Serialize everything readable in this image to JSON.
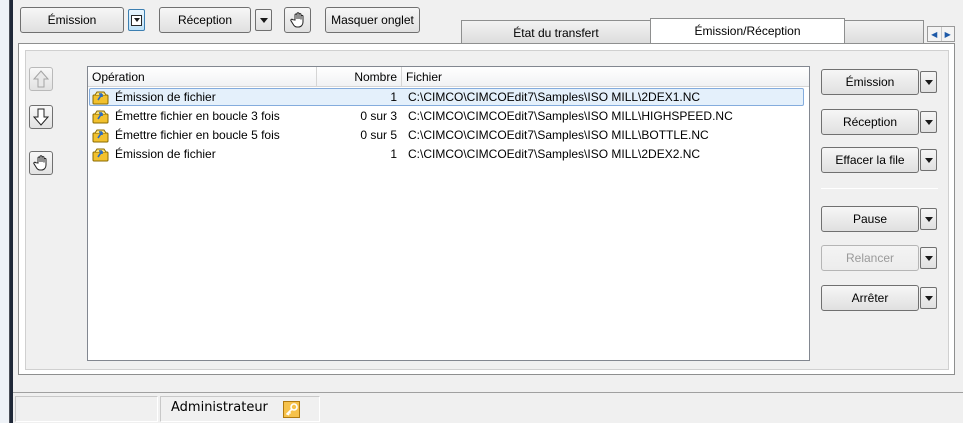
{
  "toolbar": {
    "emission_label": "Émission",
    "reception_label": "Réception",
    "hide_tabs_label": "Masquer onglet"
  },
  "tabs": [
    {
      "label": "État du transfert",
      "active": false
    },
    {
      "label": "Émission/Réception",
      "active": true
    },
    {
      "label": "",
      "active": false
    }
  ],
  "list": {
    "columns": [
      "Opération",
      "Nombre",
      "Fichier"
    ],
    "rows": [
      {
        "operation": "Émission de fichier",
        "count": "1",
        "file": "C:\\CIMCO\\CIMCOEdit7\\Samples\\ISO MILL\\2DEX1.NC",
        "selected": true
      },
      {
        "operation": "Émettre fichier en boucle 3 fois",
        "count": "0 sur 3",
        "file": "C:\\CIMCO\\CIMCOEdit7\\Samples\\ISO MILL\\HIGHSPEED.NC",
        "selected": false
      },
      {
        "operation": "Émettre fichier en boucle 5 fois",
        "count": "0 sur 5",
        "file": "C:\\CIMCO\\CIMCOEdit7\\Samples\\ISO MILL\\BOTTLE.NC",
        "selected": false
      },
      {
        "operation": "Émission de fichier",
        "count": "1",
        "file": "C:\\CIMCO\\CIMCOEdit7\\Samples\\ISO MILL\\2DEX2.NC",
        "selected": false
      }
    ]
  },
  "actions": {
    "emission": "Émission",
    "reception": "Réception",
    "clear_queue": "Effacer la file",
    "pause": "Pause",
    "restart": "Relancer",
    "stop": "Arrêter"
  },
  "status": {
    "user": "Administrateur"
  },
  "icons": {
    "move_up": "arrow-up-icon",
    "move_down": "arrow-down-icon",
    "hand": "hand-icon",
    "operation": "send-file-icon",
    "user": "key-icon"
  },
  "colors": {
    "selection_fill": "#e4f0fb",
    "selection_border": "#84acdd",
    "icon_yellow": "#f2c12e"
  }
}
